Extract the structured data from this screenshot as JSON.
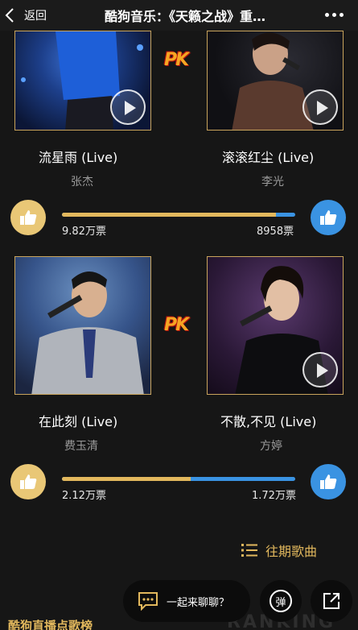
{
  "header": {
    "back_label": "返回",
    "title": "酷狗音乐：《天籁之战》重…"
  },
  "matches": [
    {
      "pk_label": "PK",
      "left": {
        "song": "流星雨 (Live)",
        "singer": "张杰",
        "votes": "9.82万票"
      },
      "right": {
        "song": "滚滚红尘 (Live)",
        "singer": "李光",
        "votes": "8958票"
      },
      "left_share": 0.916
    },
    {
      "pk_label": "PK",
      "left": {
        "song": "在此刻 (Live)",
        "singer": "费玉清",
        "votes": "2.12万票"
      },
      "right": {
        "song": "不散,不见 (Live)",
        "singer": "方婷",
        "votes": "1.72万票"
      },
      "left_share": 0.552
    }
  ],
  "history_label": "往期歌曲",
  "bottom": {
    "section_title": "酷狗直播点歌榜",
    "ranking_watermark": "RANKING",
    "chat_placeholder": "一起来聊聊？",
    "danmu_label": "弹"
  },
  "colors": {
    "gold": "#e2b85d",
    "blue": "#3a93e2",
    "background": "#161616"
  },
  "icons": [
    "back-chevron-icon",
    "more-dots-icon",
    "play-icon",
    "thumbs-up-icon",
    "list-icon",
    "chat-bubble-icon",
    "share-icon"
  ]
}
